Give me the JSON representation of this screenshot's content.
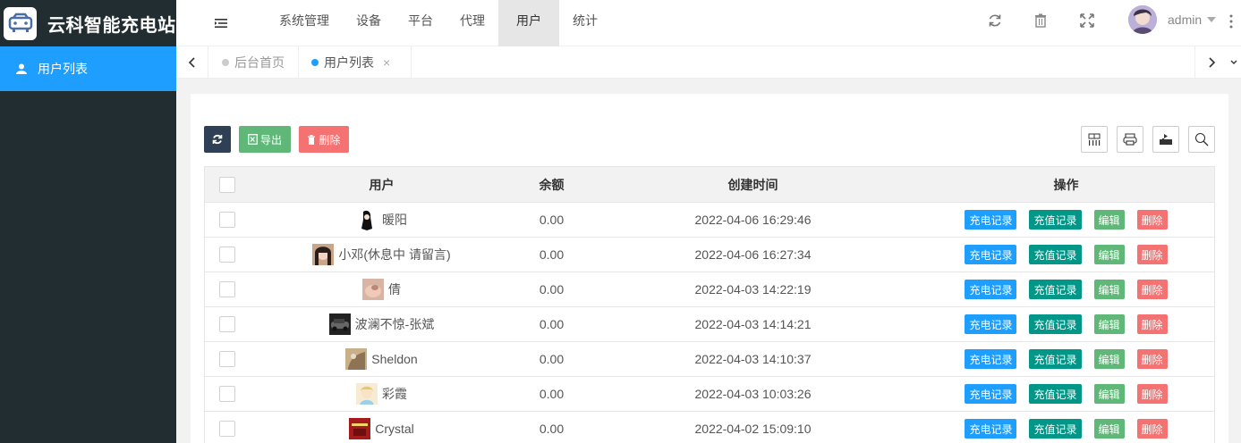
{
  "app": {
    "title": "云科智能充电站"
  },
  "sidebar": {
    "items": [
      {
        "label": "用户列表",
        "icon": "user-icon"
      }
    ]
  },
  "header": {
    "nav": [
      "系统管理",
      "设备",
      "平台",
      "代理",
      "用户",
      "统计"
    ],
    "active_nav": "用户",
    "username": "admin",
    "icons": [
      "refresh-icon",
      "trash-icon",
      "fullscreen-icon"
    ]
  },
  "tabs": [
    {
      "label": "后台首页",
      "active": false
    },
    {
      "label": "用户列表",
      "active": true,
      "close": "×"
    }
  ],
  "toolbar": {
    "export_label": "导出",
    "delete_label": "删除"
  },
  "table": {
    "columns": [
      "用户",
      "余额",
      "创建时间",
      "操作"
    ],
    "actions": {
      "charge_record": "充电记录",
      "recharge_record": "充值记录",
      "edit": "编辑",
      "delete": "删除"
    },
    "rows": [
      {
        "name": "暖阳",
        "balance": "0.00",
        "created": "2022-04-06 16:29:46"
      },
      {
        "name": "小邓(休息中 请留言)",
        "balance": "0.00",
        "created": "2022-04-06 16:27:34"
      },
      {
        "name": "倩",
        "balance": "0.00",
        "created": "2022-04-03 14:22:19"
      },
      {
        "name": "波澜不惊-张斌",
        "balance": "0.00",
        "created": "2022-04-03 14:14:21"
      },
      {
        "name": "Sheldon",
        "balance": "0.00",
        "created": "2022-04-03 14:10:37"
      },
      {
        "name": "彩霞",
        "balance": "0.00",
        "created": "2022-04-03 10:03:26"
      },
      {
        "name": "Crystal",
        "balance": "0.00",
        "created": "2022-04-02 15:09:10"
      }
    ]
  },
  "colors": {
    "sidebar_bg": "#222d32",
    "accent": "#1e9fff",
    "teal": "#009688",
    "green": "#5fb878",
    "red": "#f57272"
  }
}
